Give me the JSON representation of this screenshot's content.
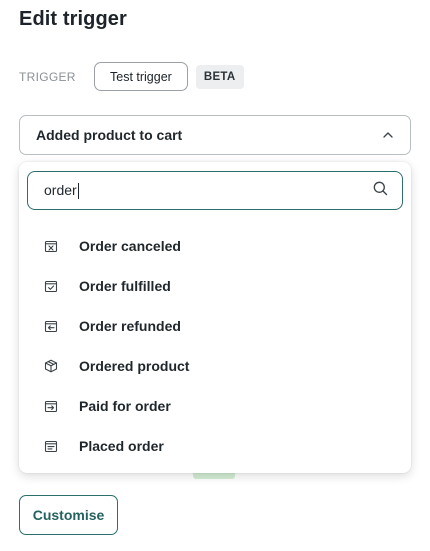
{
  "page": {
    "title": "Edit trigger"
  },
  "trigger": {
    "label": "TRIGGER",
    "test_button": "Test trigger",
    "badge": "BETA"
  },
  "select": {
    "value": "Added product to cart",
    "icon": "chevron-up-icon"
  },
  "search": {
    "value": "order",
    "icon": "search-icon"
  },
  "options": [
    {
      "label": "Order canceled",
      "icon": "order-canceled-icon"
    },
    {
      "label": "Order fulfilled",
      "icon": "order-fulfilled-icon"
    },
    {
      "label": "Order refunded",
      "icon": "order-refunded-icon"
    },
    {
      "label": "Ordered product",
      "icon": "ordered-product-icon"
    },
    {
      "label": "Paid for order",
      "icon": "paid-for-order-icon"
    },
    {
      "label": "Placed order",
      "icon": "placed-order-icon"
    }
  ],
  "footer": {
    "customise_button": "Customise"
  },
  "colors": {
    "accent": "#2a6f6c",
    "text": "#1f272c",
    "muted": "#8a9196"
  }
}
